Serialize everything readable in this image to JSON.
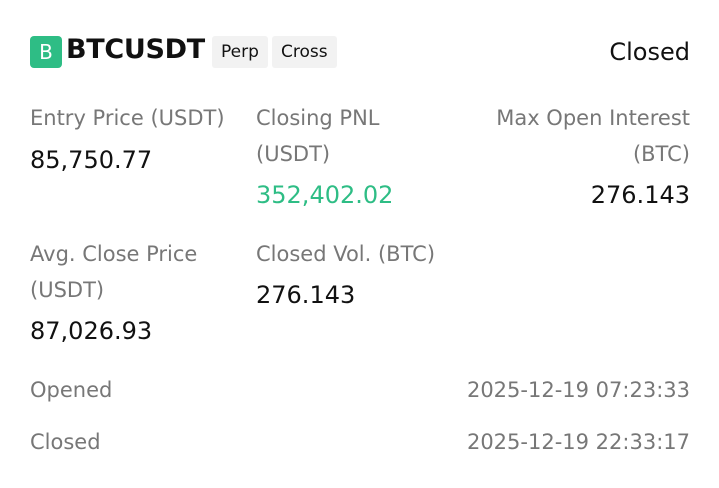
{
  "header": {
    "coin_icon_letter": "B",
    "symbol": "BTCUSDT",
    "tags": [
      "Perp",
      "Cross"
    ],
    "status": "Closed"
  },
  "stats": {
    "entry_price_label": "Entry Price (USDT)",
    "entry_price_value": "85,750.77",
    "closing_pnl_label_line1": "Closing PNL",
    "closing_pnl_label_line2": "(USDT)",
    "closing_pnl_value": "352,402.02",
    "max_open_interest_label_line1": "Max Open Interest",
    "max_open_interest_label_line2": "(BTC)",
    "max_open_interest_value": "276.143",
    "avg_close_price_label_line1": "Avg. Close Price",
    "avg_close_price_label_line2": "(USDT)",
    "avg_close_price_value": "87,026.93",
    "closed_vol_label": "Closed Vol. (BTC)",
    "closed_vol_value": "276.143"
  },
  "meta": {
    "opened_label": "Opened",
    "opened_value": "2025-12-19 07:23:33",
    "closed_label": "Closed",
    "closed_value": "2025-12-19 22:33:17"
  },
  "colors": {
    "accent_green": "#2ebd85",
    "label_gray": "#777777",
    "tag_bg": "#f2f2f2"
  }
}
